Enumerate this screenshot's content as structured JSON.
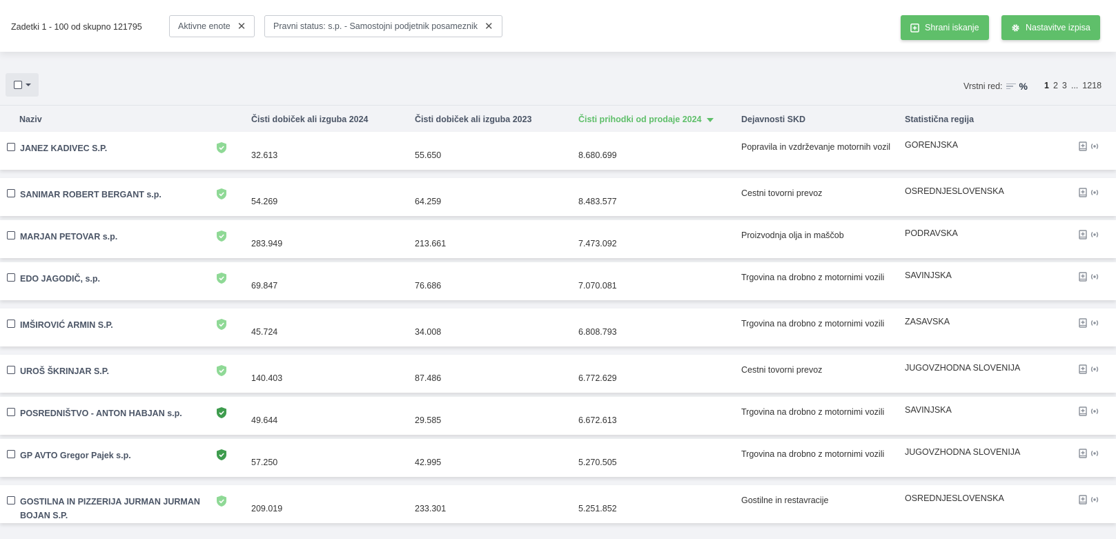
{
  "toolbar": {
    "results": "Zadetki 1 - 100 od skupno 121795",
    "chips": [
      "Aktivne enote",
      "Pravni status: s.p. - Samostojni podjetnik posameznik"
    ],
    "save_label": "Shrani iskanje",
    "settings_label": "Nastavitve izpisa"
  },
  "list": {
    "order_label": "Vrstni red:",
    "order_mode": "%",
    "pages": [
      "1",
      "2",
      "3",
      "...",
      "1218"
    ],
    "current_page": "1"
  },
  "columns": [
    "Naziv",
    "Čisti dobiček ali izguba 2024",
    "Čisti dobiček ali izguba 2023",
    "Čisti prihodki od prodaje 2024",
    "Dejavnosti SKD",
    "Statistična regija"
  ],
  "colors": {
    "accent": "#5fbf6a",
    "shield_light": "#8fd996",
    "shield_dark": "#3e9c4e"
  },
  "rows": [
    {
      "name": "JANEZ KADIVEC S.P.",
      "profit_2024": "32.613",
      "profit_2023": "55.650",
      "revenue_2024": "8.680.699",
      "skd": "Popravila in vzdrževanje motornih vozil",
      "region": "GORENJSKA",
      "shield": "light"
    },
    {
      "name": "SANIMAR ROBERT BERGANT s.p.",
      "profit_2024": "54.269",
      "profit_2023": "64.259",
      "revenue_2024": "8.483.577",
      "skd": "Cestni tovorni prevoz",
      "region": "OSREDNJESLOVENSKA",
      "shield": "light"
    },
    {
      "name": "MARJAN PETOVAR s.p.",
      "profit_2024": "283.949",
      "profit_2023": "213.661",
      "revenue_2024": "7.473.092",
      "skd": "Proizvodnja olja in maščob",
      "region": "PODRAVSKA",
      "shield": "light"
    },
    {
      "name": "EDO JAGODIČ, s.p.",
      "profit_2024": "69.847",
      "profit_2023": "76.686",
      "revenue_2024": "7.070.081",
      "skd": "Trgovina na drobno z motornimi vozili",
      "region": "SAVINJSKA",
      "shield": "light"
    },
    {
      "name": "IMŠIROVIĆ ARMIN S.P.",
      "profit_2024": "45.724",
      "profit_2023": "34.008",
      "revenue_2024": "6.808.793",
      "skd": "Trgovina na drobno z motornimi vozili",
      "region": "ZASAVSKA",
      "shield": "light"
    },
    {
      "name": "UROŠ ŠKRINJAR S.P.",
      "profit_2024": "140.403",
      "profit_2023": "87.486",
      "revenue_2024": "6.772.629",
      "skd": "Cestni tovorni prevoz",
      "region": "JUGOVZHODNA SLOVENIJA",
      "shield": "light"
    },
    {
      "name": "POSREDNIŠTVO - ANTON HABJAN s.p.",
      "profit_2024": "49.644",
      "profit_2023": "29.585",
      "revenue_2024": "6.672.613",
      "skd": "Trgovina na drobno z motornimi vozili",
      "region": "SAVINJSKA",
      "shield": "dark"
    },
    {
      "name": "GP AVTO Gregor Pajek s.p.",
      "profit_2024": "57.250",
      "profit_2023": "42.995",
      "revenue_2024": "5.270.505",
      "skd": "Trgovina na drobno z motornimi vozili",
      "region": "JUGOVZHODNA SLOVENIJA",
      "shield": "dark"
    },
    {
      "name": "GOSTILNA IN PIZZERIJA JURMAN JURMAN BOJAN S.P.",
      "profit_2024": "209.019",
      "profit_2023": "233.301",
      "revenue_2024": "5.251.852",
      "skd": "Gostilne in restavracije",
      "region": "OSREDNJESLOVENSKA",
      "shield": "light"
    }
  ]
}
